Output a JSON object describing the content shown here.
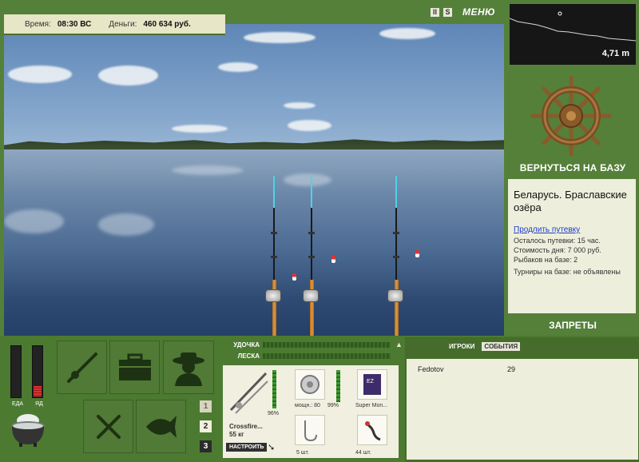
{
  "topbar": {
    "time_label": "Время:",
    "time_value": "08:30 ВС",
    "money_label": "Деньги:",
    "money_value": "460 634 руб."
  },
  "controls": {
    "pause_icon": "pause-icon",
    "sound_icon": "sound-icon",
    "menu_label": "МЕНЮ"
  },
  "depth": {
    "reading": "4,71 m"
  },
  "sidebar": {
    "return_label": "ВЕРНУТЬСЯ НА БАЗУ",
    "location": "Беларусь. Браславские озёра",
    "extend_link": "Продлить путевку",
    "remaining": "Осталось путевки: 15 час.",
    "day_cost": "Стоимость дня: 7 000 руб.",
    "fishers": "Рыбаков на базе: 2",
    "tournaments": "Турниры на базе: не объявлены",
    "bans_label": "ЗАПРЕТЫ"
  },
  "status": {
    "food_label": "ЕДА",
    "poison_label": "ЯД",
    "food_level": 0.0,
    "poison_level": 0.2
  },
  "pages": [
    "1",
    "2",
    "3"
  ],
  "gear": {
    "rod_label": "УДОЧКА",
    "line_label": "ЛЕСКА",
    "rod_name": "Crossfire...",
    "rod_weight": "55 кг",
    "rod_percent": "96%",
    "reel_power": "мощн.: 80",
    "reel_percent": "99%",
    "line_name": "Super Mon...",
    "hook_count": "5 шт.",
    "bait_count": "44 шт.",
    "tune_label": "НАСТРОИТЬ"
  },
  "events": {
    "tabs": [
      "ИГРОКИ",
      "СОБЫТИЯ"
    ],
    "rows": [
      {
        "name": "Fedotov",
        "value": "29"
      }
    ]
  },
  "colors": {
    "panel_green": "#55803a",
    "info_bg": "#eeeedd",
    "link_blue": "#1a3fc7",
    "tip_cyan": "#4dd4e4"
  }
}
